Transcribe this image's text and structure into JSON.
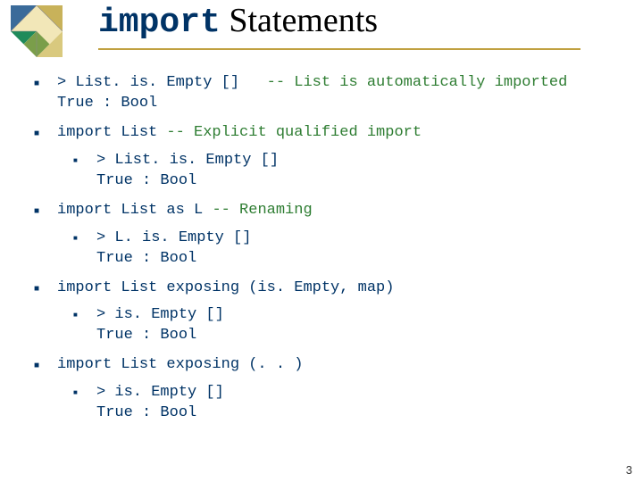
{
  "title_kw": "import",
  "title_rest": " Statements",
  "items": [
    {
      "line1a": "> List. is. Empty []   ",
      "line1b": "-- List is automatically imported",
      "line2": "True : Bool"
    },
    {
      "import_a": "import List ",
      "import_b": "-- Explicit qualified import",
      "sub": {
        "l1": "> List. is. Empty []",
        "l2": "True : Bool"
      }
    },
    {
      "import_a": "import List as L ",
      "import_b": "-- Renaming",
      "sub": {
        "l1": "> L. is. Empty []",
        "l2": "True : Bool"
      }
    },
    {
      "import_a": "import List exposing (is. Empty, map)",
      "import_b": "",
      "sub": {
        "l1": "> is. Empty []",
        "l2": "True : Bool"
      }
    },
    {
      "import_a": "import List exposing (. . )",
      "import_b": "",
      "sub": {
        "l1": "> is. Empty []",
        "l2": "True : Bool"
      }
    }
  ],
  "page_number": "3"
}
